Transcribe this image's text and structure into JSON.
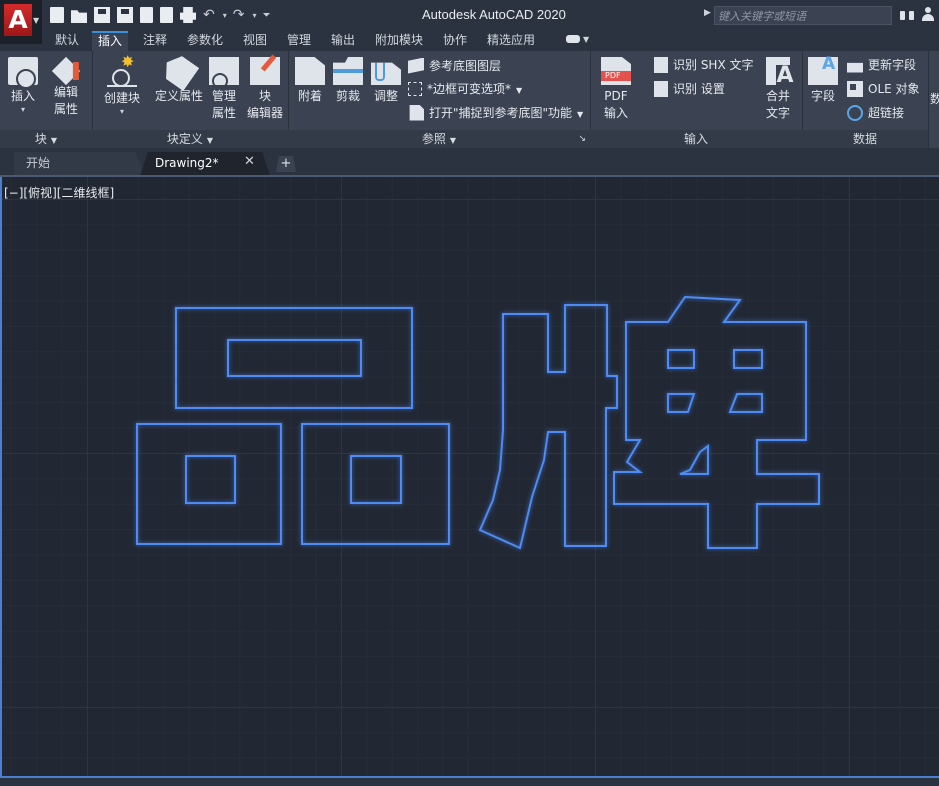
{
  "app": {
    "title": "Autodesk AutoCAD 2020",
    "logo_letter": "A",
    "search_placeholder": "键入关键字或短语"
  },
  "ribbon_tabs": [
    "默认",
    "插入",
    "注释",
    "参数化",
    "视图",
    "管理",
    "输出",
    "附加模块",
    "协作",
    "精选应用"
  ],
  "active_ribbon_tab": "插入",
  "panels": {
    "block": {
      "title": "块",
      "insert": "插入",
      "edit_attr_1": "编辑",
      "edit_attr_2": "属性"
    },
    "block_def": {
      "title": "块定义",
      "create": "创建块",
      "define_attr": "定义属性",
      "manage_1": "管理",
      "manage_2": "属性",
      "block_editor_1": "块",
      "block_editor_2": "编辑器"
    },
    "reference": {
      "title": "参照",
      "attach": "附着",
      "clip": "剪裁",
      "adjust": "调整",
      "underlay_layers": "参考底图图层",
      "frames_vary": "*边框可变选项*",
      "snap_to_underlays": "打开\"捕捉到参考底图\"功能"
    },
    "import": {
      "title": "输入",
      "pdf_import_1": "PDF",
      "pdf_import_2": "输入",
      "recognize_shx": "识别 SHX 文字",
      "recognize_settings": "识别 设置",
      "combine_text_1": "合并",
      "combine_text_2": "文字"
    },
    "data": {
      "title": "数据",
      "field": "字段",
      "update_fields": "更新字段",
      "ole_object": "OLE 对象",
      "hyperlink": "超链接"
    },
    "partial_next": "数"
  },
  "doc_tabs": {
    "start": "开始",
    "drawing": "Drawing2*",
    "close_glyph": "✕",
    "add_glyph": "+"
  },
  "viewport": {
    "label": "[−][俯视][二维线框]"
  },
  "colors": {
    "outline": "#4f8bf0",
    "accent": "#3c8fd6",
    "background": "#222833"
  }
}
